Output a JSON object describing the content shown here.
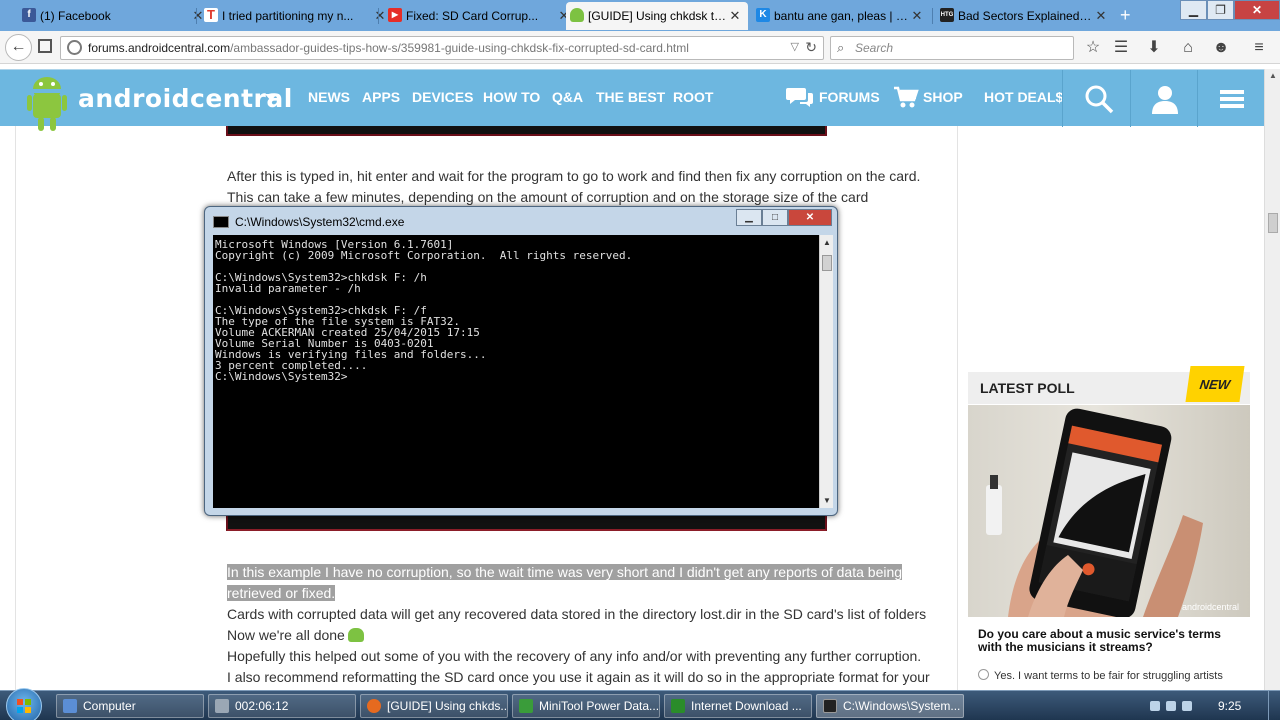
{
  "browser": {
    "tabs": [
      {
        "label": "(1) Facebook",
        "fav": "f",
        "color": "#3b5998",
        "active": false
      },
      {
        "label": "I tried partitioning my n...",
        "fav": "T",
        "color": "#e03b2f",
        "active": false
      },
      {
        "label": "Fixed: SD Card Corrup...",
        "fav": "▶",
        "color": "#e52d27",
        "active": false
      },
      {
        "label": "[GUIDE] Using chkdsk to...",
        "fav": "",
        "color": "#7dc242",
        "active": true
      },
      {
        "label": "bantu ane gan, pleas | K...",
        "fav": "K",
        "color": "#1e88e5",
        "active": false
      },
      {
        "label": "Bad Sectors Explained: ...",
        "fav": "HTG",
        "color": "#222222",
        "active": false
      }
    ],
    "url_domain": "forums.androidcentral.com",
    "url_path": "/ambassador-guides-tips-how-s/359981-guide-using-chkdsk-fix-corrupted-sd-card.html",
    "search_placeholder": "Search"
  },
  "site": {
    "logo": "androidcentral",
    "menu": [
      "NEWS",
      "APPS",
      "DEVICES",
      "HOW TO",
      "Q&A",
      "THE BEST",
      "ROOT"
    ],
    "forums": "FORUMS",
    "shop": "SHOP",
    "hot_deals": "HOT DEAL$"
  },
  "article": {
    "p1": "After this is typed in, hit enter and wait for the program to go to work and find then fix any corruption on the card. This can take a few minutes, depending on the amount of corruption and on the storage size of the card",
    "p2": "In this example I have no corruption, so the wait time was very short and I didn't get any reports of data being retrieved or fixed.",
    "p3": "Cards with corrupted data will get any recovered data stored in the directory lost.dir in the SD card's list of folders",
    "p4": "Now we're all done",
    "p5": "Hopefully this helped out some of you with the recovery of any info and/or with preventing any further corruption.",
    "p6": "I also recommend reformatting the SD card once you use it again as it will do so in the appropriate format for your"
  },
  "cmd": {
    "title": "C:\\Windows\\System32\\cmd.exe",
    "lines": [
      "Microsoft Windows [Version 6.1.7601]",
      "Copyright (c) 2009 Microsoft Corporation.  All rights reserved.",
      "",
      "C:\\Windows\\System32>chkdsk F: /h",
      "Invalid parameter - /h",
      "",
      "C:\\Windows\\System32>chkdsk F: /f",
      "The type of the file system is FAT32.",
      "Volume ACKERMAN created 25/04/2015 17:15",
      "Volume Serial Number is 0403-0201",
      "Windows is verifying files and folders...",
      "3 percent completed....",
      "C:\\Windows\\System32>"
    ]
  },
  "sidebar": {
    "poll_title": "LATEST POLL",
    "poll_badge": "NEW",
    "poll_image_caption": "androidcentral",
    "poll_question": "Do you care about a music service's terms with the musicians it streams?",
    "poll_option": "Yes. I want terms to be fair for struggling artists"
  },
  "taskbar": {
    "items": [
      {
        "label": "Computer",
        "color": "#5b8ed6"
      },
      {
        "label": "002:06:12",
        "color": "#9aa7b5"
      },
      {
        "label": "[GUIDE] Using chkds...",
        "color": "#e66a1f"
      },
      {
        "label": "MiniTool Power Data...",
        "color": "#3a9c3a"
      },
      {
        "label": "Internet Download ...",
        "color": "#2a8c2a"
      },
      {
        "label": "C:\\Windows\\System...",
        "color": "#222222"
      }
    ],
    "clock": "9:25"
  }
}
